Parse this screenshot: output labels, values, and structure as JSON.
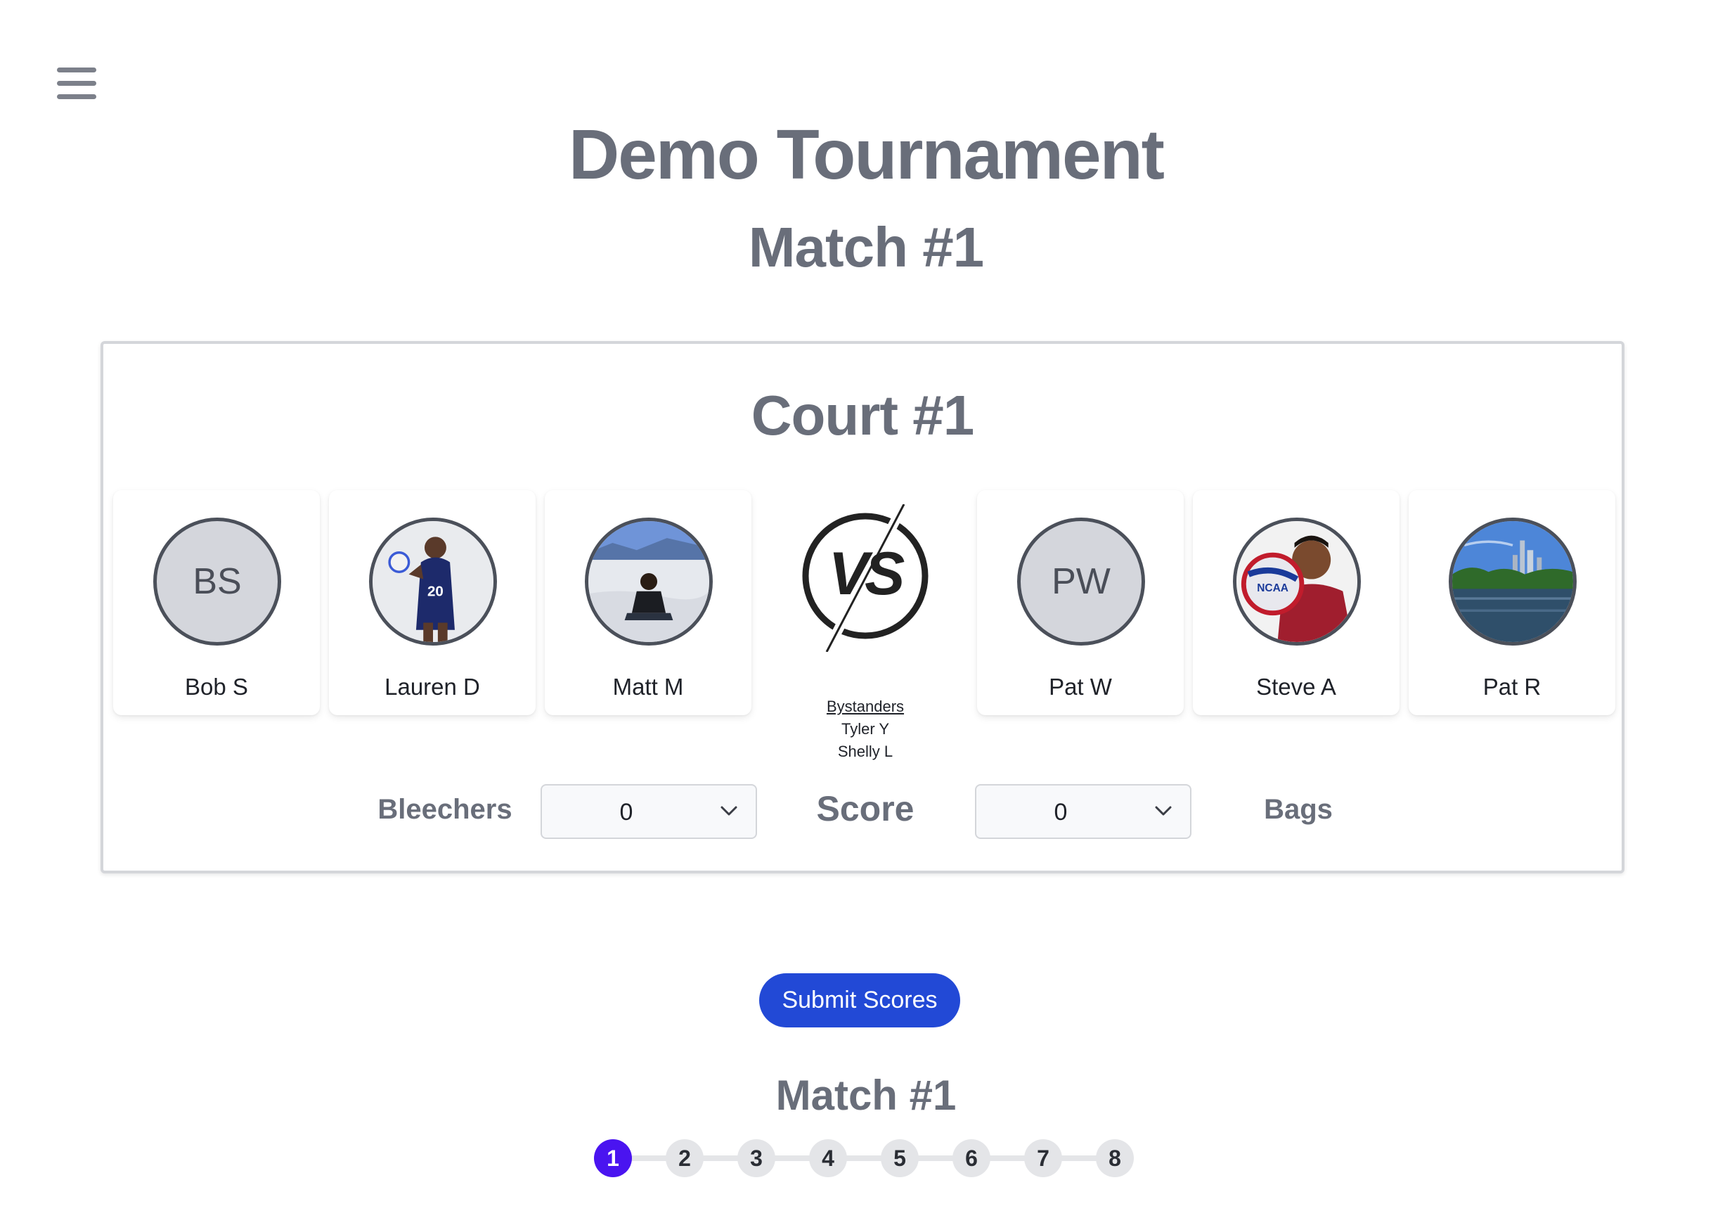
{
  "tournament": {
    "title": "Demo Tournament",
    "match_title": "Match #1"
  },
  "court": {
    "title": "Court #1",
    "team_left": {
      "name": "Bleechers",
      "players": [
        {
          "name": "Bob S",
          "initials": "BS",
          "icon": "avatar-initials"
        },
        {
          "name": "Lauren D",
          "initials": "",
          "icon": "player-photo"
        },
        {
          "name": "Matt M",
          "initials": "",
          "icon": "player-photo"
        }
      ]
    },
    "team_right": {
      "name": "Bags",
      "players": [
        {
          "name": "Pat W",
          "initials": "PW",
          "icon": "avatar-initials"
        },
        {
          "name": "Steve A",
          "initials": "",
          "icon": "player-photo"
        },
        {
          "name": "Pat R",
          "initials": "",
          "icon": "player-photo"
        }
      ]
    },
    "vs_icon": "vs-logo-icon",
    "bystanders": {
      "heading": "Bystanders",
      "names": [
        "Tyler Y",
        "Shelly L"
      ]
    },
    "score_label": "Score",
    "score_left": "0",
    "score_right": "0"
  },
  "actions": {
    "submit_label": "Submit Scores"
  },
  "match_nav": {
    "title": "Match #1",
    "steps": [
      "1",
      "2",
      "3",
      "4",
      "5",
      "6",
      "7",
      "8"
    ],
    "active_index": 0
  },
  "colors": {
    "primary_button": "#2249d6",
    "active_step": "#4a14f0",
    "heading_gray": "#696e7a"
  }
}
